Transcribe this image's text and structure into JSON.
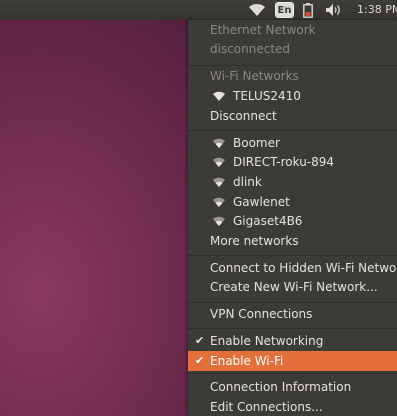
{
  "panel": {
    "keyboard_layout": "En",
    "clock": "1:38 PM",
    "icons": [
      "wifi-icon",
      "keyboard-layout-indicator",
      "battery-icon",
      "volume-icon"
    ]
  },
  "menu": {
    "ethernet_header": "Ethernet Network",
    "ethernet_status": "disconnected",
    "wifi_header": "Wi-Fi Networks",
    "connected_network": "TELUS2410",
    "disconnect": "Disconnect",
    "networks": [
      "Boomer",
      "DIRECT-roku-894",
      "dlink",
      "Gawlenet",
      "Gigaset4B6"
    ],
    "more_networks": "More networks",
    "connect_hidden": "Connect to Hidden Wi-Fi Network...",
    "create_new": "Create New Wi-Fi Network...",
    "vpn": "VPN Connections",
    "enable_networking": "Enable Networking",
    "enable_wifi": "Enable Wi-Fi",
    "connection_info": "Connection Information",
    "edit_connections": "Edit Connections...",
    "check_mark": "✔"
  },
  "colors": {
    "menu_bg": "#3c3b37",
    "highlight": "#e36f3a",
    "panel_bg": "#3c3b37",
    "desktop": "#6c2a4c"
  }
}
